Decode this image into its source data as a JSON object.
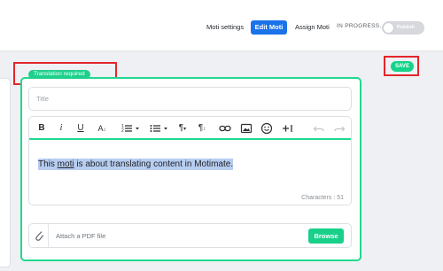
{
  "header": {
    "nav": [
      "Moti settings",
      "Edit Moti",
      "Assign Moti"
    ],
    "status": "IN PROGRESS...",
    "toggle_label": "Publish"
  },
  "save_label": "SAVE",
  "card": {
    "badge": "Translation required",
    "title_placeholder": "Title",
    "toolbar_icons": [
      "bold-icon",
      "italic-icon",
      "underline-icon",
      "font-size-icon",
      "numbered-list-icon",
      "bullet-list-icon",
      "paragraph-icon",
      "paragraph-format-icon",
      "link-icon",
      "image-icon",
      "emoji-icon",
      "insert-more-icon",
      "undo-icon",
      "redo-icon"
    ],
    "content": {
      "pre": "This ",
      "underlined": "moti",
      "post": " is about translating content in Motimate."
    },
    "char_count": "Characters : 51",
    "attach_placeholder": "Attach a PDF file",
    "browse_label": "Browse"
  },
  "colors": {
    "accent_green": "#20d88f",
    "primary_blue": "#1a73e8",
    "annotation_red": "#e3262a",
    "highlight": "#b7cdf0"
  }
}
